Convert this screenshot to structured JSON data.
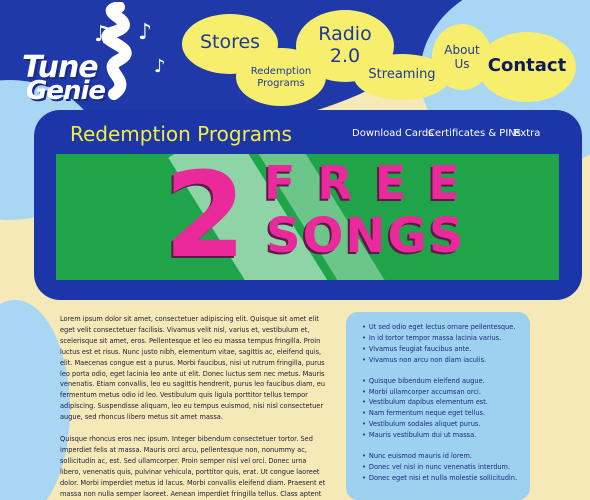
{
  "logo": {
    "line1": "Tune",
    "line2": "Genie"
  },
  "nav": {
    "stores": "Stores",
    "redemption_line1": "Redemption",
    "redemption_line2": "Programs",
    "radio_line1": "Radio",
    "radio_line2": "2.0",
    "streaming": "Streaming",
    "about_line1": "About",
    "about_line2": "Us",
    "contact": "Contact"
  },
  "panel": {
    "title": "Redemption Programs",
    "subnav": [
      "Download Cards",
      "Certificates & PINs",
      "Extra"
    ]
  },
  "banner": {
    "number": "2",
    "word1": "FREE",
    "word2": "SONGS"
  },
  "body": {
    "paragraphs": [
      "Lorem ipsum dolor sit amet, consectetuer adipiscing elit. Quisque sit amet elit eget velit consectetuer facilisis. Vivamus velit nisl, varius et, vestibulum et, scelerisque sit amet, eros. Pellentesque et leo eu massa tempus fringilla. Proin luctus est et risus. Nunc justo nibh, elementum vitae, sagittis ac, eleifend quis, elit. Maecenas congue est a purus. Morbi faucibus, nisi ut rutrum fringilla, purus leo porta odio, eget lacinia leo ante ut elit. Donec luctus sem nec metus. Mauris venenatis. Etiam convallis, leo eu sagittis hendrerit, purus leo faucibus diam, eu fermentum metus odio id leo. Vestibulum quis ligula porttitor tellus tempor adipiscing. Suspendisse aliquam, leo eu tempus euismod, nisi nisl consectetuer augue, sed rhoncus libero metus sit amet massa.",
      "Quisque rhoncus eros nec ipsum. Integer bibendum consectetuer tortor. Sed imperdiet felis at massa. Mauris orci arcu, pellentesque non, nonummy ac, sollicitudin ac, est. Sed ullamcorper. Proin semper nisl vel orci. Donec urna libero, venenatis quis, pulvinar vehicula, porttitor quis, erat. Ut congue laoreet dolor. Morbi imperdiet metus id lacus. Morbi convallis eleifend diam. Praesent et massa non nulla semper laoreet. Aenean imperdiet fringilla tellus. Class aptent taciti sociosqu ad litora"
    ]
  },
  "sidebar": {
    "group1": [
      "Ut sed odio eget lectus ornare pellentesque.",
      "In id tortor tempor massa lacinia varius.",
      "Vivamus feugiat faucibus ante.",
      "Vivamus non arcu non diam iaculis."
    ],
    "group2": [
      "Quisque bibendum eleifend augue.",
      "Morbi ullamcorper accumsan orci.",
      "Vestibulum dapibus elementum est.",
      "Nam fermentum neque eget tellus.",
      "Vestibulum sodales aliquet purus.",
      "Mauris vestibulum dui ut massa."
    ],
    "group3": [
      "Nunc euismod mauris id lorem.",
      "Donec vel nisl in nunc venenatis interdum.",
      "Donec eget nisi et nulla molestie sollicitudin."
    ]
  },
  "colors": {
    "navy": "#1c35a8",
    "bubble_yellow": "#f8ee6e",
    "banner_green": "#1fa44a",
    "banner_pink": "#ea2a9a",
    "title_yellow": "#f4ee3c",
    "sidebar_blue": "#9ed0ef"
  }
}
